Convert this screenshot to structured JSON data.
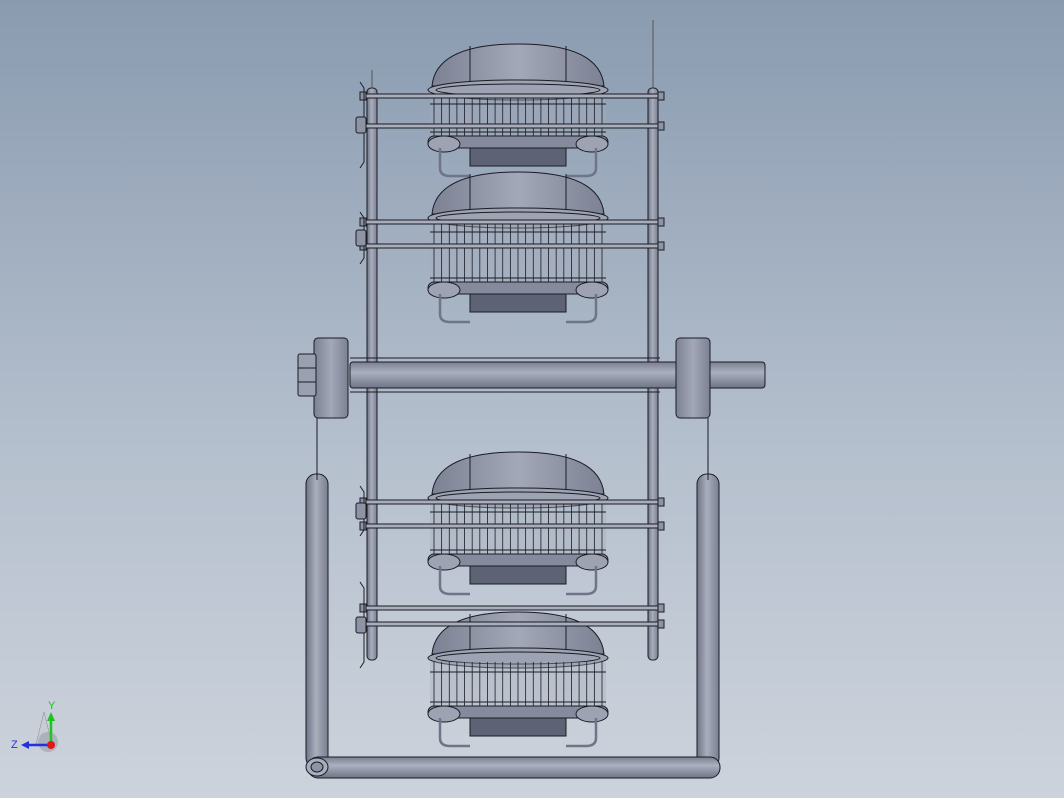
{
  "viewport": {
    "background_top": "#8a9bb0",
    "background_bottom": "#cdd3dc"
  },
  "model": {
    "body_color": "#8e94a6",
    "body_light": "#a9aebd",
    "body_dark": "#6f7486",
    "line_color": "#1a1c24"
  },
  "triad": {
    "y_label": "Y",
    "z_label": "Z",
    "y_color": "#1ec41e",
    "z_color": "#2233dd",
    "x_color": "#e01818"
  }
}
